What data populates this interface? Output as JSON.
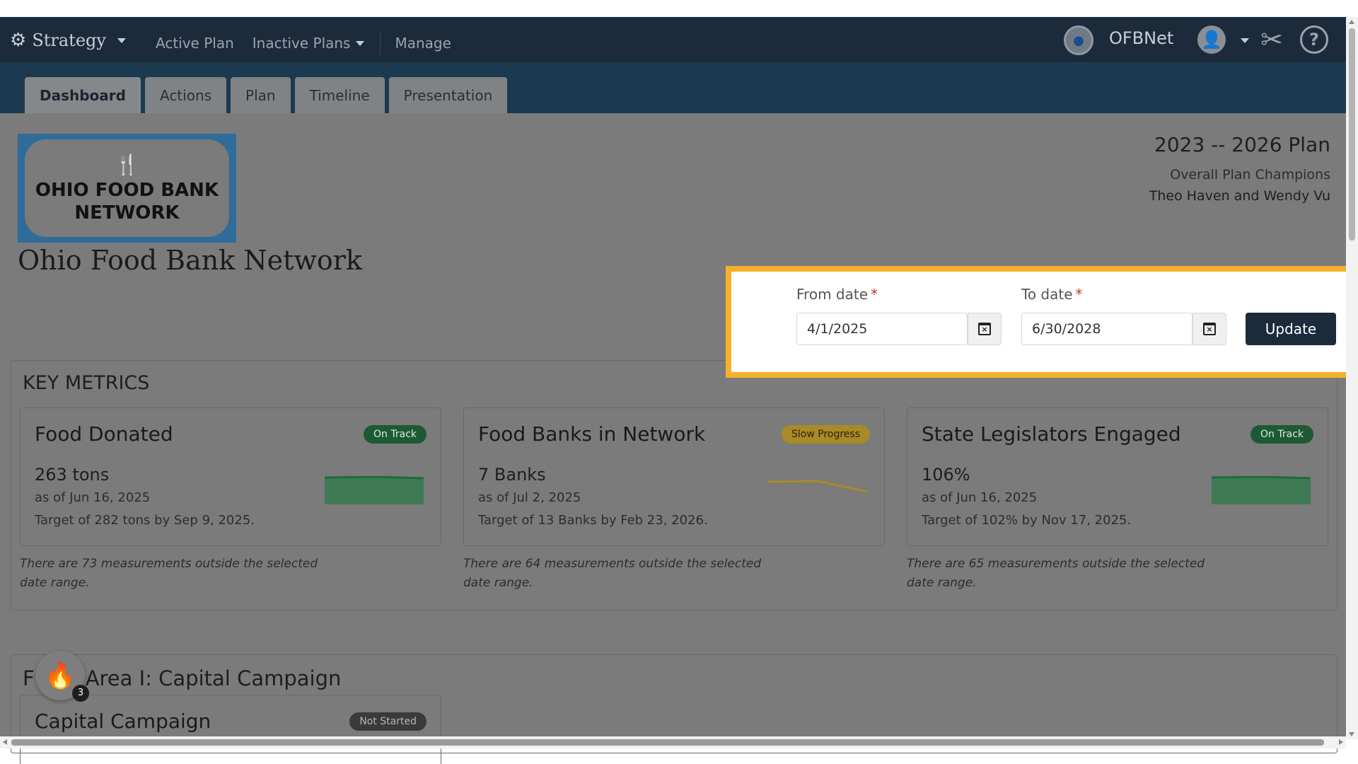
{
  "app": {
    "brand": "Strategy",
    "nav": [
      "Active Plan",
      "Inactive Plans",
      "Manage"
    ],
    "org_name": "OFBNet",
    "icons": {
      "brand": "gear-icon",
      "tools": "tools-icon",
      "help": "help-icon",
      "avatar": "user-avatar-icon"
    }
  },
  "tabs": [
    "Dashboard",
    "Actions",
    "Plan",
    "Timeline",
    "Presentation"
  ],
  "header": {
    "logo_line1": "OHIO FOOD BANK",
    "logo_line2": "NETWORK",
    "org_title": "Ohio Food Bank Network",
    "plan_title": "2023 -- 2026 Plan",
    "plan_sub": "Overall Plan Champions",
    "plan_champions": "Theo Haven and Wendy Vu"
  },
  "date_filter": {
    "from_label": "From date",
    "from_value": "4/1/2025",
    "to_label": "To date",
    "to_value": "6/30/2028",
    "required_mark": "*",
    "update_label": "Update",
    "highlight_color": "#f5b12a"
  },
  "metrics": {
    "title": "KEY METRICS",
    "cards": [
      {
        "name": "Food Donated",
        "status": "On Track",
        "value": "263 tons",
        "as_of": "as of Jun 16, 2025",
        "target": "Target of 282 tons by Sep 9, 2025.",
        "note": "There are 73 measurements outside the selected date range.",
        "trend": "flat-area"
      },
      {
        "name": "Food Banks in Network",
        "status": "Slow Progress",
        "value": "7 Banks",
        "as_of": "as of Jul 2, 2025",
        "target": "Target of 13 Banks by Feb 23, 2026.",
        "note": "There are 64 measurements outside the selected date range.",
        "trend": "declining-line"
      },
      {
        "name": "State Legislators Engaged",
        "status": "On Track",
        "value": "106%",
        "as_of": "as of Jun 16, 2025",
        "target": "Target of 102% by Nov 17, 2025.",
        "note": "There are 65 measurements outside the selected date range.",
        "trend": "flat-area"
      }
    ]
  },
  "focus_area": {
    "title_prefix": "F",
    "title": "Area I: Capital Campaign",
    "card_title": "Capital Campaign",
    "card_status": "Not Started"
  },
  "fab": {
    "count": "3",
    "icon": "fire-icon"
  },
  "colors": {
    "navbar": "#1c2b3c",
    "tabbar": "#1c3a4f",
    "on_track": "#1d5a34",
    "slow": "#a88a26",
    "not_started": "#3a3a3a"
  }
}
